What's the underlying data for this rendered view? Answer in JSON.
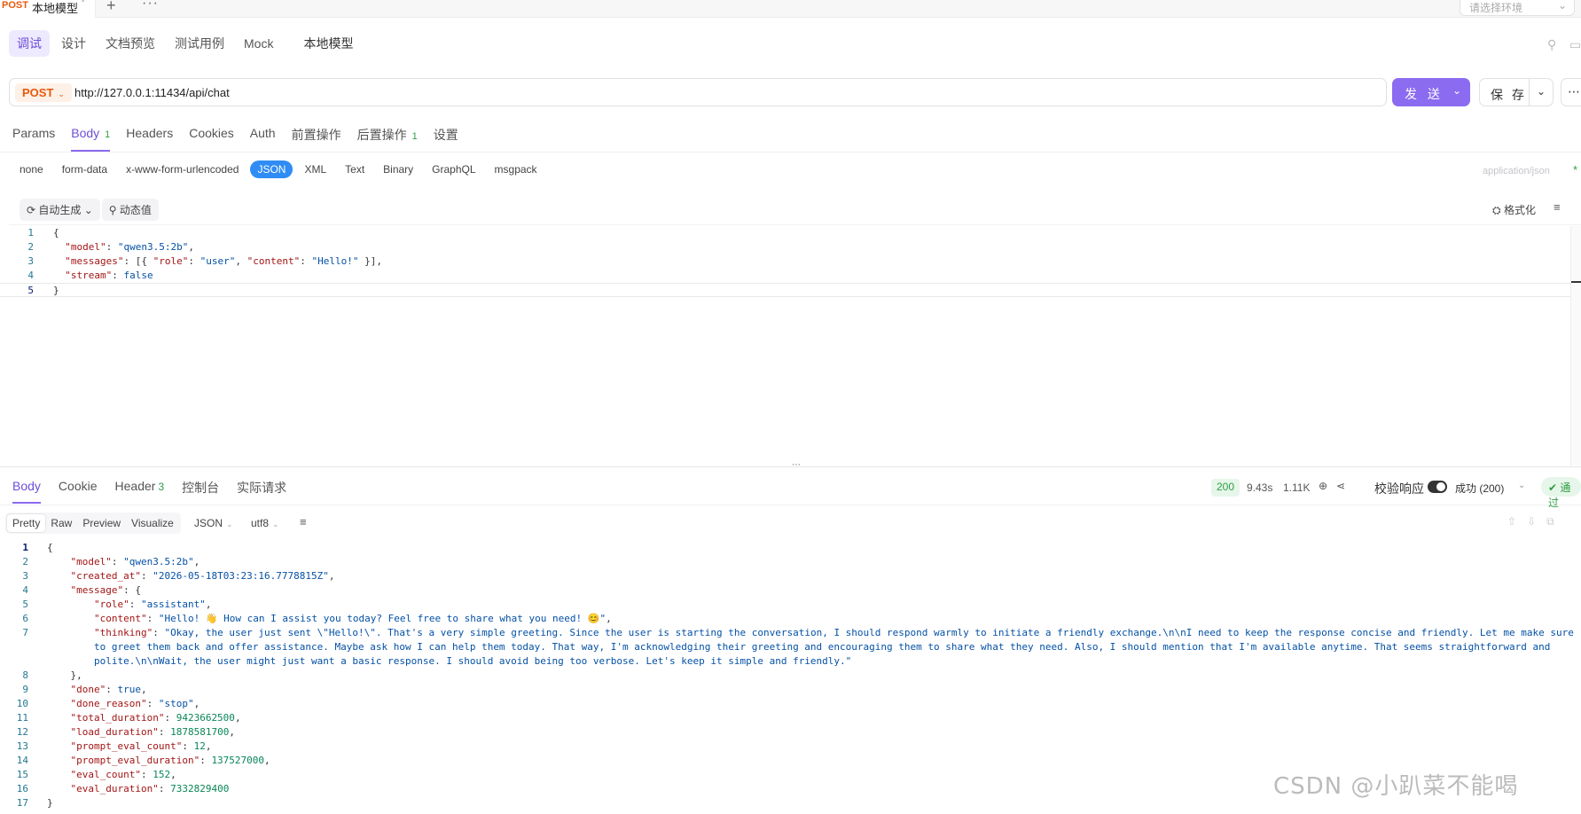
{
  "tabbar": {
    "tab_method": "POST",
    "tab_title": "本地模型",
    "tab_close": "˟",
    "new_tab": "+",
    "more": "···",
    "env_placeholder": "请选择环境"
  },
  "subnav": {
    "items": [
      "调试",
      "设计",
      "文档预览",
      "测试用例",
      "Mock"
    ],
    "api_name": "本地模型"
  },
  "request": {
    "method": "POST",
    "url": "http://127.0.0.1:11434/api/chat",
    "send_label": "发 送",
    "save_label": "保 存",
    "more_label": "⋯"
  },
  "req_tabs": [
    {
      "label": "Params",
      "badge": ""
    },
    {
      "label": "Body",
      "badge": "1"
    },
    {
      "label": "Headers",
      "badge": ""
    },
    {
      "label": "Cookies",
      "badge": ""
    },
    {
      "label": "Auth",
      "badge": ""
    },
    {
      "label": "前置操作",
      "badge": ""
    },
    {
      "label": "后置操作",
      "badge": "1"
    },
    {
      "label": "设置",
      "badge": ""
    }
  ],
  "body_types": [
    "none",
    "form-data",
    "x-www-form-urlencoded",
    "JSON",
    "XML",
    "Text",
    "Binary",
    "GraphQL",
    "msgpack"
  ],
  "body_type_selected": "JSON",
  "content_type": "application/json",
  "content_type_mark": "*",
  "editor_toolbar": {
    "auto_generate": "自动生成",
    "dynamic_value": "动态值",
    "format": "格式化"
  },
  "request_body_lines": [
    "{",
    "  \"model\": \"qwen3.5:2b\",",
    "  \"messages\": [{ \"role\": \"user\", \"content\": \"Hello!\" }],",
    "  \"stream\": false",
    "}"
  ],
  "response": {
    "tabs": [
      {
        "label": "Body",
        "badge": ""
      },
      {
        "label": "Cookie",
        "badge": ""
      },
      {
        "label": "Header",
        "badge": "3"
      },
      {
        "label": "控制台",
        "badge": ""
      },
      {
        "label": "实际请求",
        "badge": ""
      }
    ],
    "status_code": "200",
    "time": "9.43s",
    "size": "1.11K",
    "verify_label": "校验响应",
    "verify_on": true,
    "result": "成功 (200)",
    "pass_label": "通过",
    "view_modes": [
      "Pretty",
      "Raw",
      "Preview",
      "Visualize"
    ],
    "view_selected": "Pretty",
    "format": "JSON",
    "encoding": "utf8"
  },
  "response_body_lines": [
    "{",
    "    \"model\": \"qwen3.5:2b\",",
    "    \"created_at\": \"2026-05-18T03:23:16.7778815Z\",",
    "    \"message\": {",
    "        \"role\": \"assistant\",",
    "        \"content\": \"Hello! 👋 How can I assist you today? Feel free to share what you need! 😊\",",
    "        \"thinking\": \"Okay, the user just sent \\\"Hello!\\\". That's a very simple greeting. Since the user is starting the conversation, I should respond warmly to initiate a friendly exchange.\\n\\nI need to keep the response concise and friendly. Let me make sure",
    "        to greet them back and offer assistance. Maybe ask how I can help them today. That way, I'm acknowledging their greeting and encouraging them to share what they need. Also, I should mention that I'm available anytime. That seems straightforward and",
    "        polite.\\n\\nWait, the user might just want a basic response. I should avoid being too verbose. Let's keep it simple and friendly.\"",
    "    },",
    "    \"done\": true,",
    "    \"done_reason\": \"stop\",",
    "    \"total_duration\": 9423662500,",
    "    \"load_duration\": 1878581700,",
    "    \"prompt_eval_count\": 12,",
    "    \"prompt_eval_duration\": 137527000,",
    "    \"eval_count\": 152,",
    "    \"eval_duration\": 7332829400",
    "}"
  ],
  "response_line_numbers": [
    "1",
    "2",
    "3",
    "4",
    "5",
    "6",
    "7",
    "",
    "",
    "8",
    "9",
    "10",
    "11",
    "12",
    "13",
    "14",
    "15",
    "16",
    "17"
  ],
  "watermark": "CSDN @小趴菜不能喝"
}
